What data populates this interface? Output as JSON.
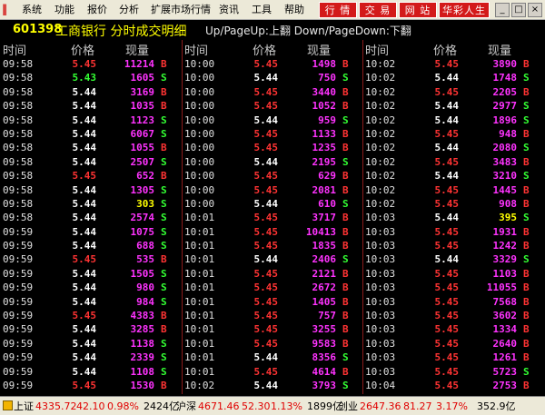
{
  "menubar": {
    "items": [
      "系统",
      "功能",
      "报价",
      "分析",
      "扩展市场行情",
      "资讯",
      "工具",
      "帮助"
    ],
    "buttons": [
      "行 情",
      "交 易",
      "网 站",
      "华彩人生"
    ],
    "win": [
      "_",
      "□",
      "×"
    ]
  },
  "title": {
    "code": "601398",
    "name": "工商银行 分时成交明细",
    "hint": "Up/PageUp:上翻 Down/PageDown:下翻"
  },
  "headers": {
    "time": "时间",
    "price": "价格",
    "volume": "现量"
  },
  "columns": [
    [
      [
        "09:58",
        "5.45",
        "up",
        "11214",
        "pur",
        "B"
      ],
      [
        "09:58",
        "5.43",
        "down",
        "1605",
        "pur",
        "S"
      ],
      [
        "09:58",
        "5.44",
        "flat",
        "3169",
        "pur",
        "B"
      ],
      [
        "09:58",
        "5.44",
        "flat",
        "1035",
        "pur",
        "B"
      ],
      [
        "09:58",
        "5.44",
        "flat",
        "1123",
        "pur",
        "S"
      ],
      [
        "09:58",
        "5.44",
        "flat",
        "6067",
        "pur",
        "S"
      ],
      [
        "09:58",
        "5.44",
        "flat",
        "1055",
        "pur",
        "B"
      ],
      [
        "09:58",
        "5.44",
        "flat",
        "2507",
        "pur",
        "S"
      ],
      [
        "09:58",
        "5.45",
        "up",
        "652",
        "pur",
        "B"
      ],
      [
        "09:58",
        "5.44",
        "flat",
        "1305",
        "pur",
        "S"
      ],
      [
        "09:58",
        "5.44",
        "flat",
        "303",
        "yel",
        "S"
      ],
      [
        "09:58",
        "5.44",
        "flat",
        "2574",
        "pur",
        "S"
      ],
      [
        "09:59",
        "5.44",
        "flat",
        "1075",
        "pur",
        "S"
      ],
      [
        "09:59",
        "5.44",
        "flat",
        "688",
        "pur",
        "S"
      ],
      [
        "09:59",
        "5.45",
        "up",
        "535",
        "pur",
        "B"
      ],
      [
        "09:59",
        "5.44",
        "flat",
        "1505",
        "pur",
        "S"
      ],
      [
        "09:59",
        "5.44",
        "flat",
        "980",
        "pur",
        "S"
      ],
      [
        "09:59",
        "5.44",
        "flat",
        "984",
        "pur",
        "S"
      ],
      [
        "09:59",
        "5.45",
        "up",
        "4383",
        "pur",
        "B"
      ],
      [
        "09:59",
        "5.44",
        "flat",
        "3285",
        "pur",
        "B"
      ],
      [
        "09:59",
        "5.44",
        "flat",
        "1138",
        "pur",
        "S"
      ],
      [
        "09:59",
        "5.44",
        "flat",
        "2339",
        "pur",
        "S"
      ],
      [
        "09:59",
        "5.44",
        "flat",
        "1108",
        "pur",
        "S"
      ],
      [
        "09:59",
        "5.45",
        "up",
        "1530",
        "pur",
        "B"
      ]
    ],
    [
      [
        "10:00",
        "5.45",
        "up",
        "1498",
        "pur",
        "B"
      ],
      [
        "10:00",
        "5.44",
        "flat",
        "750",
        "pur",
        "S"
      ],
      [
        "10:00",
        "5.45",
        "up",
        "3440",
        "pur",
        "B"
      ],
      [
        "10:00",
        "5.45",
        "up",
        "1052",
        "pur",
        "B"
      ],
      [
        "10:00",
        "5.44",
        "flat",
        "959",
        "pur",
        "S"
      ],
      [
        "10:00",
        "5.45",
        "up",
        "1133",
        "pur",
        "B"
      ],
      [
        "10:00",
        "5.45",
        "up",
        "1235",
        "pur",
        "B"
      ],
      [
        "10:00",
        "5.44",
        "flat",
        "2195",
        "pur",
        "S"
      ],
      [
        "10:00",
        "5.45",
        "up",
        "629",
        "pur",
        "B"
      ],
      [
        "10:00",
        "5.45",
        "up",
        "2081",
        "pur",
        "B"
      ],
      [
        "10:00",
        "5.44",
        "flat",
        "610",
        "pur",
        "S"
      ],
      [
        "10:01",
        "5.45",
        "up",
        "3717",
        "pur",
        "B"
      ],
      [
        "10:01",
        "5.45",
        "up",
        "10413",
        "pur",
        "B"
      ],
      [
        "10:01",
        "5.45",
        "up",
        "1835",
        "pur",
        "B"
      ],
      [
        "10:01",
        "5.44",
        "flat",
        "2406",
        "pur",
        "S"
      ],
      [
        "10:01",
        "5.45",
        "up",
        "2121",
        "pur",
        "B"
      ],
      [
        "10:01",
        "5.45",
        "up",
        "2672",
        "pur",
        "B"
      ],
      [
        "10:01",
        "5.45",
        "up",
        "1405",
        "pur",
        "B"
      ],
      [
        "10:01",
        "5.45",
        "up",
        "757",
        "pur",
        "B"
      ],
      [
        "10:01",
        "5.45",
        "up",
        "3255",
        "pur",
        "B"
      ],
      [
        "10:01",
        "5.45",
        "up",
        "9583",
        "pur",
        "B"
      ],
      [
        "10:01",
        "5.44",
        "flat",
        "8356",
        "pur",
        "S"
      ],
      [
        "10:01",
        "5.45",
        "up",
        "4614",
        "pur",
        "B"
      ],
      [
        "10:02",
        "5.44",
        "flat",
        "3793",
        "pur",
        "S"
      ]
    ],
    [
      [
        "10:02",
        "5.45",
        "up",
        "3890",
        "pur",
        "B"
      ],
      [
        "10:02",
        "5.44",
        "flat",
        "1748",
        "pur",
        "S"
      ],
      [
        "10:02",
        "5.45",
        "up",
        "2205",
        "pur",
        "B"
      ],
      [
        "10:02",
        "5.44",
        "flat",
        "2977",
        "pur",
        "S"
      ],
      [
        "10:02",
        "5.44",
        "flat",
        "1896",
        "pur",
        "S"
      ],
      [
        "10:02",
        "5.45",
        "up",
        "948",
        "pur",
        "B"
      ],
      [
        "10:02",
        "5.44",
        "flat",
        "2080",
        "pur",
        "S"
      ],
      [
        "10:02",
        "5.45",
        "up",
        "3483",
        "pur",
        "B"
      ],
      [
        "10:02",
        "5.44",
        "flat",
        "3210",
        "pur",
        "S"
      ],
      [
        "10:02",
        "5.45",
        "up",
        "1445",
        "pur",
        "B"
      ],
      [
        "10:02",
        "5.45",
        "up",
        "908",
        "pur",
        "B"
      ],
      [
        "10:03",
        "5.44",
        "flat",
        "395",
        "yel",
        "S"
      ],
      [
        "10:03",
        "5.45",
        "up",
        "1931",
        "pur",
        "B"
      ],
      [
        "10:03",
        "5.45",
        "up",
        "1242",
        "pur",
        "B"
      ],
      [
        "10:03",
        "5.44",
        "flat",
        "3329",
        "pur",
        "S"
      ],
      [
        "10:03",
        "5.45",
        "up",
        "1103",
        "pur",
        "B"
      ],
      [
        "10:03",
        "5.45",
        "up",
        "11055",
        "pur",
        "B"
      ],
      [
        "10:03",
        "5.45",
        "up",
        "7568",
        "pur",
        "B"
      ],
      [
        "10:03",
        "5.45",
        "up",
        "3602",
        "pur",
        "B"
      ],
      [
        "10:03",
        "5.45",
        "up",
        "1334",
        "pur",
        "B"
      ],
      [
        "10:03",
        "5.45",
        "up",
        "2640",
        "pur",
        "B"
      ],
      [
        "10:03",
        "5.45",
        "up",
        "1261",
        "pur",
        "B"
      ],
      [
        "10:03",
        "5.45",
        "up",
        "5723",
        "pur",
        "S"
      ],
      [
        "10:04",
        "5.45",
        "up",
        "2753",
        "pur",
        "B"
      ]
    ]
  ],
  "status": {
    "sh_label": "上证",
    "sh_index": "4335.72",
    "sh_chg": "42.10",
    "sh_pct": "0.98%",
    "sh_amt": "2424亿",
    "hs_label": "沪深",
    "hs_index": "4671.46",
    "hs_chg": "52.30",
    "hs_pct": "1.13%",
    "hs_amt": "1899亿",
    "cy_label": "创业",
    "cy_index": "2647.36",
    "cy_chg": "81.27",
    "cy_pct": "3.17%",
    "cy_amt": "352.9亿"
  },
  "colors": {
    "up": "#ff3333",
    "down": "#33ff33",
    "flat": "#ffffff",
    "volume": "#ff33ff",
    "highlight": "#ffff00",
    "separator": "#8a1a1a"
  }
}
